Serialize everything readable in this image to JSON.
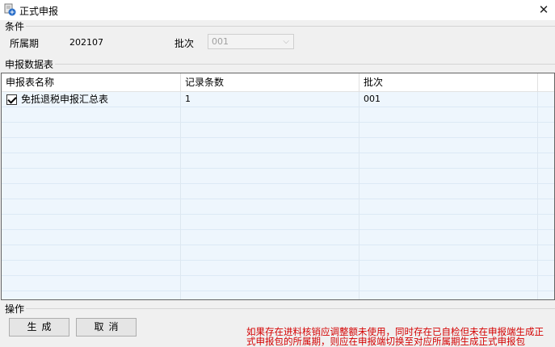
{
  "window": {
    "title": "正式申报",
    "icon": "app-icon",
    "close_symbol": "✕"
  },
  "conditions": {
    "section_label": "条件",
    "period_label": "所属期",
    "period_value": "202107",
    "batch_label": "批次",
    "batch_selected": "001"
  },
  "table": {
    "section_label": "申报数据表",
    "columns": [
      "申报表名称",
      "记录条数",
      "批次"
    ],
    "rows": [
      {
        "checked": true,
        "name": "免抵退税申报汇总表",
        "count": "1",
        "batch": "001"
      }
    ]
  },
  "actions": {
    "section_label": "操作",
    "generate_label": "生成",
    "cancel_label": "取消"
  },
  "notice": {
    "line1": "如果存在进料核销应调整额未使用，同时存在已自检但未在申报端生成正",
    "line2": "式申报包的所属期，则应在申报端切换至对应所属期生成正式申报包",
    "color": "#d40000"
  }
}
